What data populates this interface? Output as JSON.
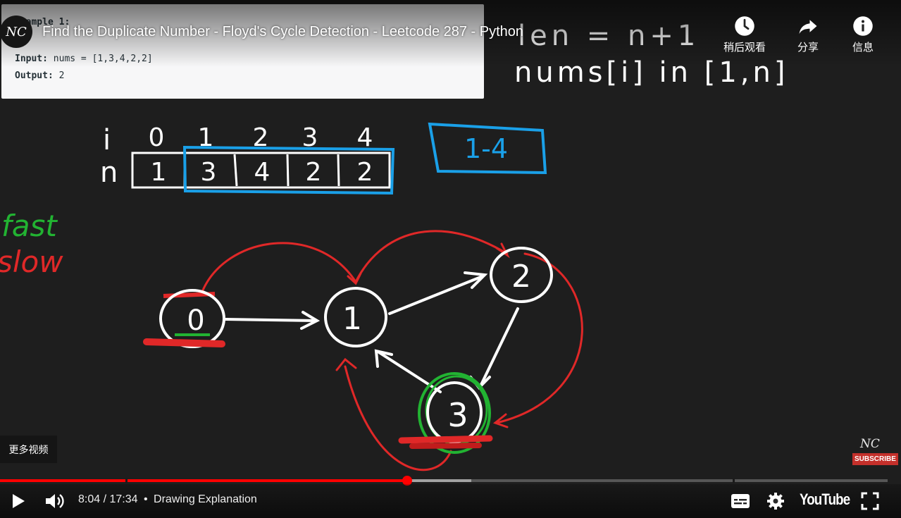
{
  "player": {
    "video_title": "Find the Duplicate Number - Floyd's Cycle Detection - Leetcode 287 - Python",
    "channel_avatar_text": "NC",
    "actions": {
      "watch_later": "稍后观看",
      "share": "分享",
      "info": "信息"
    },
    "more_videos": "更多视频",
    "watermark": {
      "logo": "NC",
      "subscribe": "SUBSCRIBE"
    },
    "time": {
      "current": "8:04",
      "duration": "17:34",
      "separator": " / ",
      "bullet": "•"
    },
    "chapter": "Drawing Explanation",
    "progress": {
      "played_fraction": 0.459,
      "buffered_fraction": 0.531
    },
    "youtube_label": "YouTube",
    "colors": {
      "accent": "#ff0000",
      "chalk_white": "#ffffff",
      "chalk_red": "#e02828",
      "chalk_green": "#22b332",
      "chalk_blue": "#1aa0e8"
    }
  },
  "example": {
    "title": "Example 1:",
    "input_label": "Input:",
    "input_value": "nums = [1,3,4,2,2]",
    "output_label": "Output:",
    "output_value": "2"
  },
  "board": {
    "formula_line1": "len = n+1",
    "formula_line2": "nums[i] in [1,n]",
    "row_label_i": "i",
    "row_label_n": "n",
    "indices": [
      "0",
      "1",
      "2",
      "3",
      "4"
    ],
    "values": [
      "1",
      "3",
      "4",
      "2",
      "2"
    ],
    "range_box": "1-4",
    "legend_fast": "fast",
    "legend_slow": "slow",
    "nodes": [
      "0",
      "1",
      "2",
      "3"
    ]
  }
}
